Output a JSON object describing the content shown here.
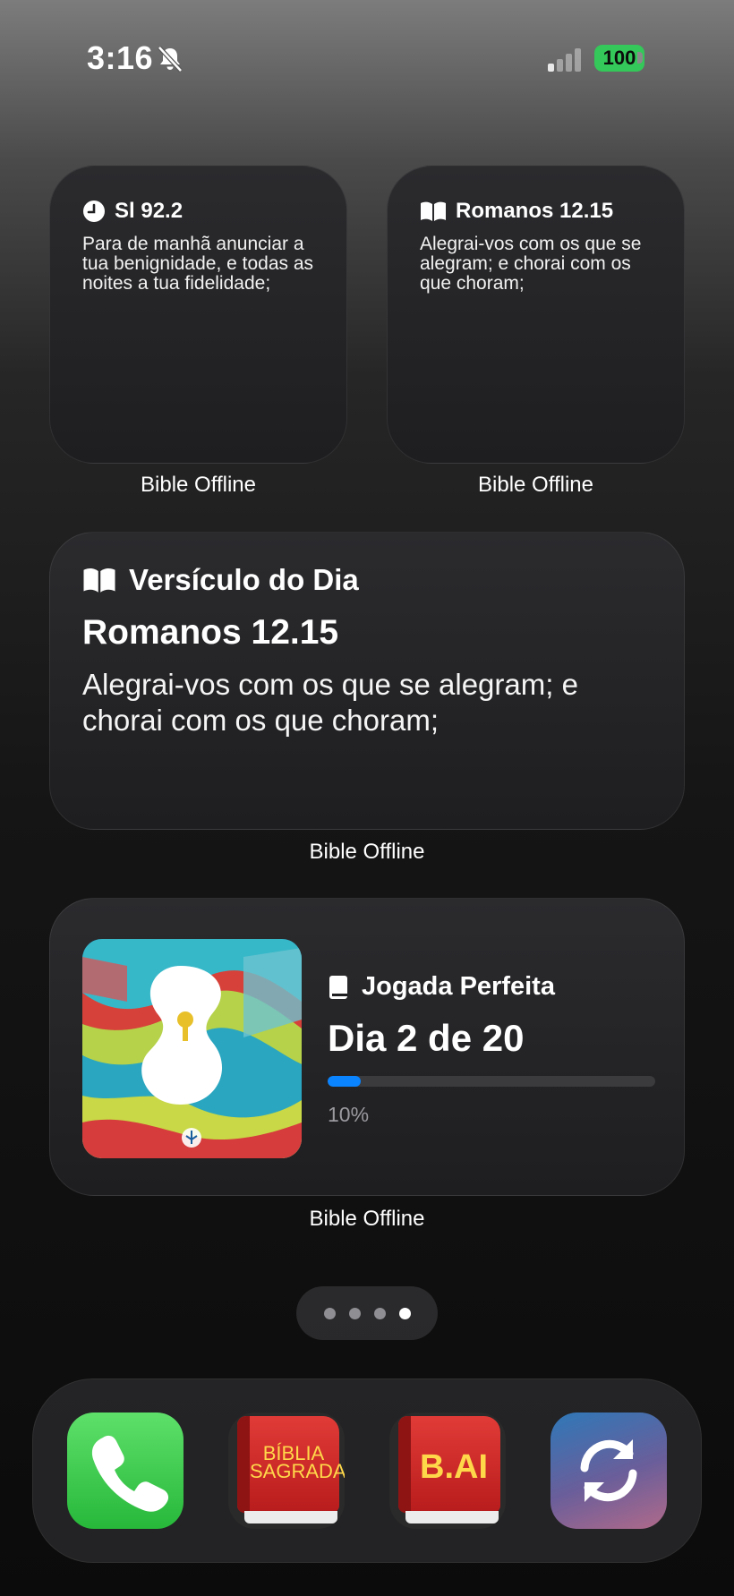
{
  "status_bar": {
    "time": "3:16",
    "battery": "100"
  },
  "widgets": {
    "small_1": {
      "reference": "Sl 92.2",
      "text": "Para de manhã anunciar a tua benignidade, e todas as noites a tua fidelidade;",
      "label": "Bible Offline"
    },
    "small_2": {
      "reference": "Romanos 12.15",
      "text": "Alegrai-vos com os que se alegram; e chorai com os que choram;",
      "label": "Bible Offline"
    },
    "verse_of_day": {
      "title": "Versículo do Dia",
      "reference": "Romanos 12.15",
      "text": "Alegrai-vos com os que se alegram; e chorai com os que choram;",
      "label": "Bible Offline"
    },
    "reading_plan": {
      "title": "Jogada Perfeita",
      "day": "Dia 2 de 20",
      "progress_percent": 10,
      "progress_text": "10%",
      "label": "Bible Offline"
    }
  },
  "page_dots": {
    "count": 4,
    "active_index": 3
  },
  "dock": {
    "apps": [
      {
        "name": "Phone",
        "icon": "phone-icon"
      },
      {
        "name": "Bíblia Sagrada",
        "icon_text": "BÍBLIA SAGRADA"
      },
      {
        "name": "B.AI",
        "icon_text": "B.AI"
      },
      {
        "name": "Sync",
        "icon": "sync-icon"
      }
    ]
  },
  "colors": {
    "battery": "#34c759",
    "progress": "#0a84ff",
    "book_red": "#d42a2a",
    "book_text": "#ffd84a"
  }
}
